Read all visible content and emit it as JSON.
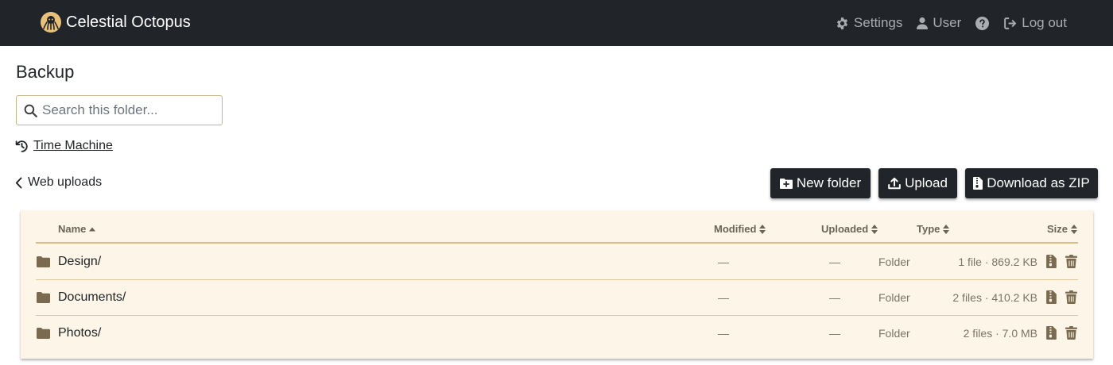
{
  "navbar": {
    "brand": "Celestial Octopus",
    "links": {
      "settings": "Settings",
      "user": "User",
      "logout": "Log out"
    }
  },
  "page": {
    "title": "Backup",
    "search_placeholder": "Search this folder...",
    "time_machine": "Time Machine",
    "back_label": "Web uploads"
  },
  "toolbar": {
    "new_folder": "New folder",
    "upload": "Upload",
    "download_zip": "Download as ZIP"
  },
  "table": {
    "headers": {
      "name": "Name",
      "modified": "Modified",
      "uploaded": "Uploaded",
      "type": "Type",
      "size": "Size"
    },
    "sort": {
      "column": "name",
      "direction": "asc"
    },
    "rows": [
      {
        "name": "Design/",
        "modified": "—",
        "uploaded": "—",
        "type": "Folder",
        "size": "1 file · 869.2 KB"
      },
      {
        "name": "Documents/",
        "modified": "—",
        "uploaded": "—",
        "type": "Folder",
        "size": "2 files · 410.2 KB"
      },
      {
        "name": "Photos/",
        "modified": "—",
        "uploaded": "—",
        "type": "Folder",
        "size": "2 files · 7.0 MB"
      }
    ]
  },
  "colors": {
    "navbar_bg": "#212529",
    "accent_border": "#d9bd85",
    "table_bg": "#fdf6e8",
    "icon_brown": "#7a6a4f"
  },
  "icons": {
    "brand": "octopus-logo-icon",
    "settings": "gear-icon",
    "user": "user-icon",
    "help": "question-circle-icon",
    "logout": "logout-icon",
    "search": "search-icon",
    "time_machine": "history-icon",
    "back": "chevron-left-icon",
    "folder": "folder-icon",
    "zip": "zip-file-icon",
    "trash": "trash-icon"
  }
}
